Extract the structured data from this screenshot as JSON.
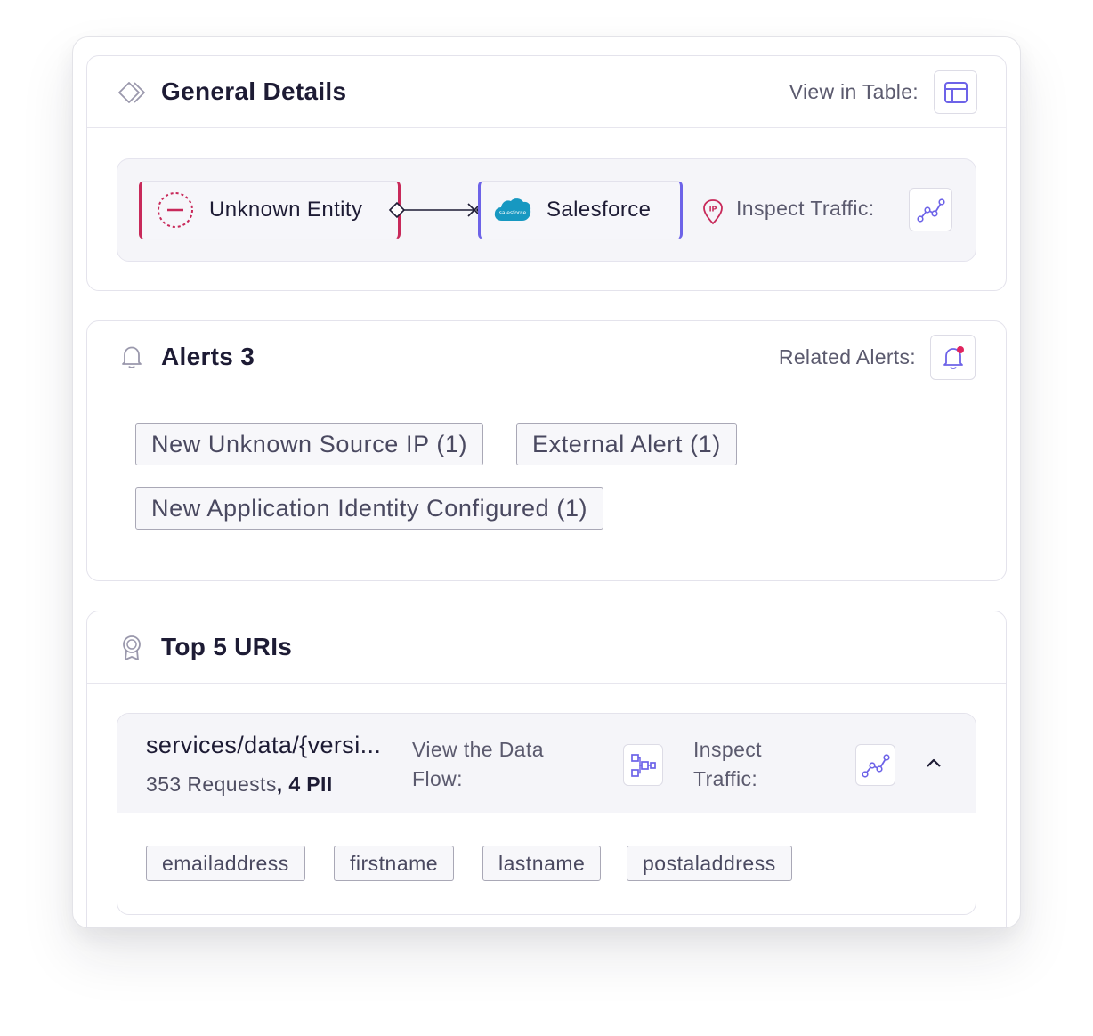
{
  "general": {
    "title": "General Details",
    "view_in_table_label": "View in Table:",
    "source_entity": "Unknown Entity",
    "destination_entity": "Salesforce",
    "destination_logo_text": "salesforce",
    "ip_badge": "IP",
    "inspect_traffic_label": "Inspect Traffic:"
  },
  "alerts": {
    "title": "Alerts",
    "count": "3",
    "related_alerts_label": "Related Alerts:",
    "tags": [
      "New Unknown Source IP (1)",
      "External Alert (1)",
      "New Application Identity Configured (1)"
    ]
  },
  "uris": {
    "title": "Top 5 URIs",
    "items": [
      {
        "path": "services/data/{versi...",
        "requests": "353 Requests",
        "separator": ",",
        "pii": "4 PII",
        "data_flow_label": "View the Data Flow:",
        "inspect_traffic_label": "Inspect Traffic:",
        "pii_fields": [
          "emailaddress",
          "firstname",
          "lastname",
          "postaladdress"
        ]
      }
    ]
  },
  "colors": {
    "accent": "#6d63e8",
    "unknown_entity": "#c8295a",
    "salesforce": "#1798c1",
    "notification_dot": "#e0245e"
  }
}
